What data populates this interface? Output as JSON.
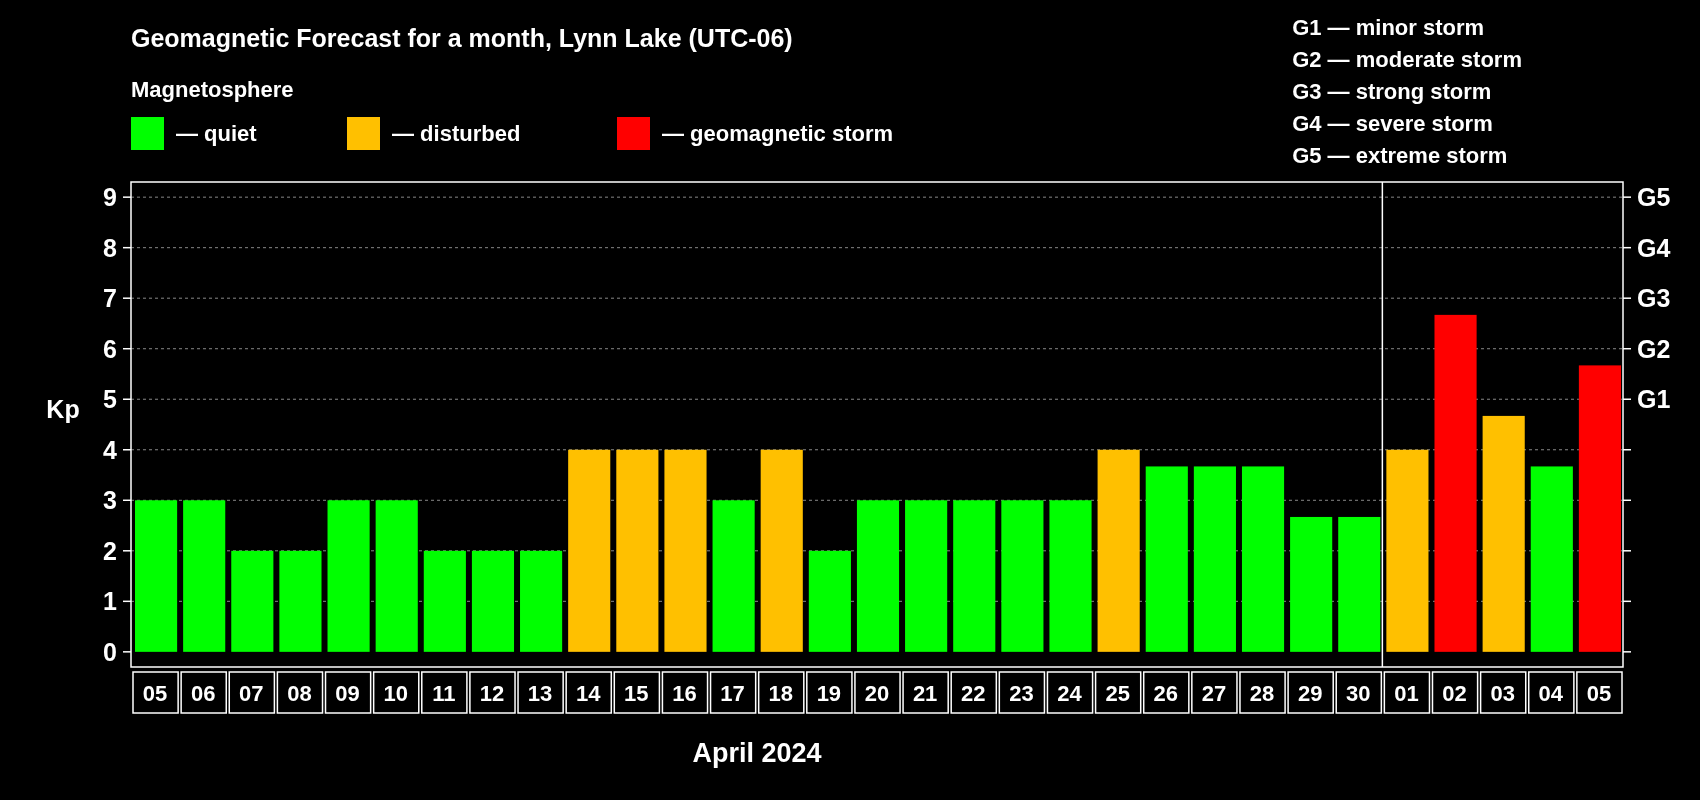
{
  "title": "Geomagnetic Forecast for a month, Lynn Lake (UTC-06)",
  "legend": {
    "title": "Magnetosphere",
    "items": [
      {
        "label": "— quiet",
        "color": "#00ff00"
      },
      {
        "label": "— disturbed",
        "color": "#ffc000"
      },
      {
        "label": "— geomagnetic storm",
        "color": "#ff0000"
      }
    ]
  },
  "scale": [
    "G1 — minor storm",
    "G2 — moderate storm",
    "G3 — strong storm",
    "G4 — severe storm",
    "G5 — extreme storm"
  ],
  "chart_data": {
    "type": "bar",
    "xlabel": "April 2024",
    "ylabel": "Kp",
    "categories": [
      "05",
      "06",
      "07",
      "08",
      "09",
      "10",
      "11",
      "12",
      "13",
      "14",
      "15",
      "16",
      "17",
      "18",
      "19",
      "20",
      "21",
      "22",
      "23",
      "24",
      "25",
      "26",
      "27",
      "28",
      "29",
      "30",
      "01",
      "02",
      "03",
      "04",
      "05"
    ],
    "series": [
      {
        "values": [
          3,
          3,
          2,
          2,
          3,
          3,
          2,
          2,
          2,
          4,
          4,
          4,
          3,
          4,
          2,
          3,
          3,
          3,
          3,
          3,
          4,
          3.67,
          3.67,
          3.67,
          2.67,
          2.67,
          4,
          6.67,
          4.67,
          3.67,
          5.67
        ]
      }
    ],
    "ylim": [
      -0.3,
      9.3
    ],
    "yticks": [
      0,
      1,
      2,
      3,
      4,
      5,
      6,
      7,
      8,
      9
    ],
    "grid": true
  },
  "storm_axis_labels": [
    "G5",
    "G4",
    "G3",
    "G2",
    "G1"
  ]
}
